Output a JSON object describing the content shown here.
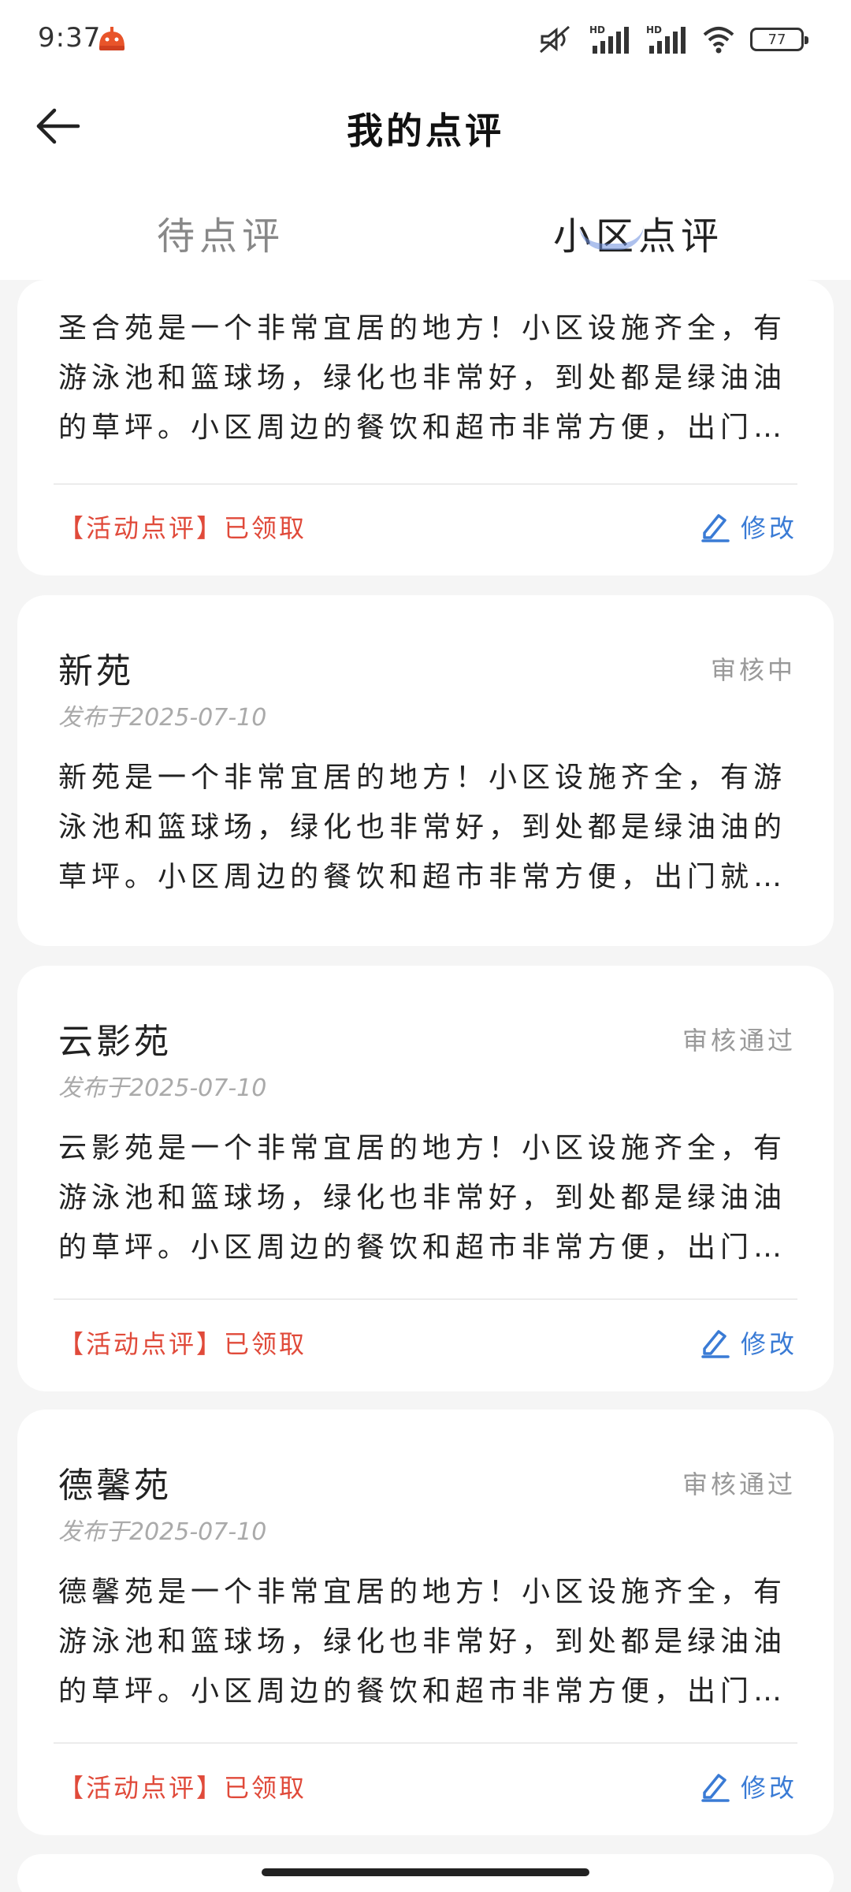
{
  "status_bar": {
    "time": "9:37",
    "battery": "77",
    "icons": [
      "app-notification-icon",
      "mute-icon",
      "hd-signal-icon",
      "hd-signal-icon",
      "wifi-icon",
      "battery-icon"
    ]
  },
  "header": {
    "title": "我的点评",
    "back_icon": "arrow-left-icon"
  },
  "tabs": [
    {
      "label": "待点评",
      "active": false
    },
    {
      "label": "小区点评",
      "active": true
    }
  ],
  "colors": {
    "accent": "#3a7bd5",
    "tag_red": "#e04a3a",
    "muted": "#999999",
    "background": "#f5f5f5"
  },
  "reviews": [
    {
      "name": "",
      "status": "",
      "date": "",
      "content": "圣合苑是一个非常宜居的地方！小区设施齐全，有游泳池和篮球场，绿化也非常好，到处都是绿油油的草坪。小区周边的餐饮和超市非常方便，出门就是公…",
      "tag": "【活动点评】已领取",
      "edit_label": "修改"
    },
    {
      "name": "新苑",
      "status": "审核中",
      "date": "发布于2025-07-10",
      "content": "新苑是一个非常宜居的地方！小区设施齐全，有游泳池和篮球场，绿化也非常好，到处都是绿油油的草坪。小区周边的餐饮和超市非常方便，出门就是公…"
    },
    {
      "name": "云影苑",
      "status": "审核通过",
      "date": "发布于2025-07-10",
      "content": "云影苑是一个非常宜居的地方！小区设施齐全，有游泳池和篮球场，绿化也非常好，到处都是绿油油的草坪。小区周边的餐饮和超市非常方便，出门就是公…",
      "tag": "【活动点评】已领取",
      "edit_label": "修改"
    },
    {
      "name": "德馨苑",
      "status": "审核通过",
      "date": "发布于2025-07-10",
      "content": "德馨苑是一个非常宜居的地方！小区设施齐全，有游泳池和篮球场，绿化也非常好，到处都是绿油油的草坪。小区周边的餐饮和超市非常方便，出门就是公…",
      "tag": "【活动点评】已领取",
      "edit_label": "修改"
    }
  ]
}
